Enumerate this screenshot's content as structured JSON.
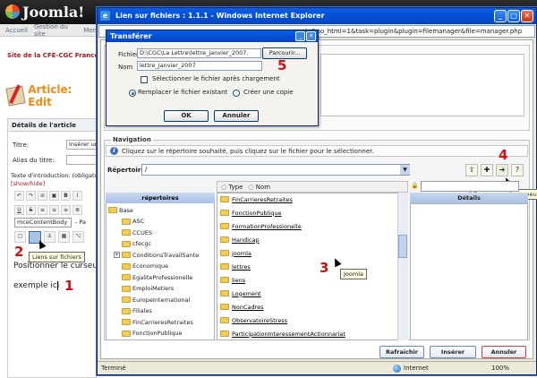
{
  "background": {
    "logo_text": "Joomla!",
    "menu": [
      "Accueil",
      "Gestion du site",
      "Men"
    ],
    "site_name": "Site de la CFE-CGC France T",
    "article_title": "Article: Edit",
    "panel_title": "Détails de l'article",
    "fields": {
      "titre_label": "Titre:",
      "titre_value": "Insérer un",
      "alias_label": "Alias du titre:",
      "intro_label": "Texte d'introduction: (obligatoi",
      "show_hide": "[show/hide]"
    },
    "style_select": "mceContentBody",
    "style_select_extra": "- Pa",
    "tooltip_fichiers": "Liens sur fichiers",
    "position_text": "Positionner le curseur",
    "example_text": "exemple ici",
    "numbers": {
      "one": "1",
      "two": "2"
    }
  },
  "ie": {
    "title": "Lien sur fichiers : 1.1.1 - Windows Internet Explorer",
    "address": "te&no_html=1&task=plugin&plugin=filemanager&file=manager.php",
    "status": "Terminé",
    "zone": "Internet",
    "zoom": "100%"
  },
  "navigation": {
    "legend": "Navigation",
    "instruction": "Cliquez sur le répertoire souhaité, puis cliquez sur le fichier pour le sélectionner.",
    "repertoire_label": "Répertoire",
    "repertoire_value": "/",
    "number_four": "4",
    "number_three": "3",
    "upload_tooltip": "Envoyer sur le serveur",
    "hover_tooltip": "Joomla",
    "dir_header": "répertoires",
    "type_header": "Type",
    "name_header": "Nom",
    "details_header": "Détails",
    "directories": [
      {
        "label": "Base",
        "plus": false,
        "indent": 0
      },
      {
        "label": "ASC",
        "plus": false,
        "indent": 1
      },
      {
        "label": "CCUES",
        "plus": false,
        "indent": 1
      },
      {
        "label": "cfecgc",
        "plus": false,
        "indent": 1
      },
      {
        "label": "ConditionsTravailSante",
        "plus": true,
        "indent": 1
      },
      {
        "label": "Economique",
        "plus": false,
        "indent": 1
      },
      {
        "label": "EgaliteProfessionelle",
        "plus": false,
        "indent": 1
      },
      {
        "label": "EmploiMetiers",
        "plus": false,
        "indent": 1
      },
      {
        "label": "EuropeInternational",
        "plus": false,
        "indent": 1
      },
      {
        "label": "Filiales",
        "plus": false,
        "indent": 1
      },
      {
        "label": "FinCarrieresRetraites",
        "plus": false,
        "indent": 1
      },
      {
        "label": "FonctionPublique",
        "plus": false,
        "indent": 1
      }
    ],
    "files": [
      "FinCarrieresRetraites",
      "FonctionPublique",
      "FormationProfessionelle",
      "Handicap",
      "joomla",
      "lettres",
      "liens",
      "Logement",
      "NonCadres",
      "ObservatoireStress",
      "ParticipationInteressementActionnariat"
    ],
    "buttons": {
      "refresh": "Rafraichir",
      "insert": "Insérer",
      "cancel": "Annuler"
    }
  },
  "dialog": {
    "title": "Transférer",
    "fichier_label": "Fichier",
    "fichier_value": "D:\\CGC\\La Lettre\\lettre_janvier_2007.",
    "browse_label": "Parcourir...",
    "nom_label": "Nom",
    "nom_value": "lettre_janvier_2007",
    "number_five": "5",
    "checkbox_label": "Sélectionner le fichier après chargement",
    "radio_replace": "Remplacer le fichier existant",
    "radio_copy": "Créer une copie",
    "ok": "OK",
    "cancel": "Annuler"
  },
  "colors": {
    "accent_red": "#d01010",
    "title_blue": "#0553d7",
    "folder": "#f2cc58"
  }
}
